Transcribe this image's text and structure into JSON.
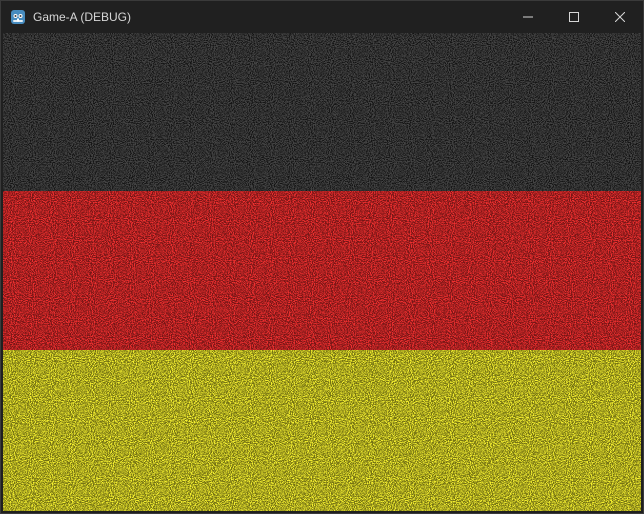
{
  "window": {
    "title": "Game-A (DEBUG)",
    "app_icon": "godot-engine-icon",
    "controls": {
      "minimize_icon": "minimize-icon",
      "maximize_icon": "maximize-icon",
      "close_icon": "close-icon"
    }
  },
  "game_view": {
    "description_colors": {
      "top_band": "#141414",
      "middle_band": "#ff3333",
      "bottom_band": "#ffff33",
      "noise": "#000000"
    },
    "bands": [
      {
        "name": "black-band",
        "color": "#141414",
        "noise_color": "#6a6a6a",
        "noise_opacity": 0.55
      },
      {
        "name": "red-band",
        "color": "#f03030",
        "noise_color": "#1a0000",
        "noise_opacity": 0.55
      },
      {
        "name": "yellow-band",
        "color": "#f5f030",
        "noise_color": "#1a1a00",
        "noise_opacity": 0.6
      }
    ]
  },
  "colors": {
    "titlebar_bg": "#202020",
    "title_text": "#d6d6d6",
    "border": "#3a3a3a"
  }
}
